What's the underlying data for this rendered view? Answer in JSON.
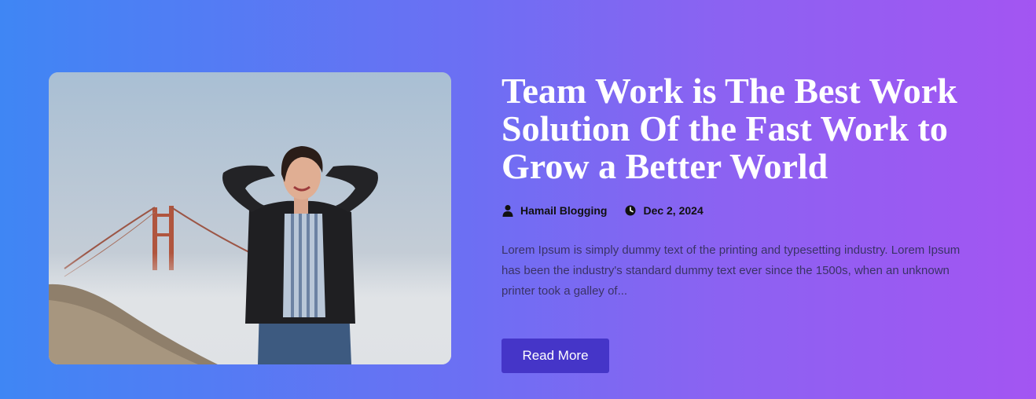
{
  "post": {
    "image_alt": "Woman in leather jacket smiling with eyes closed in front of fog-covered bridge",
    "title": "Team Work is The Best Work Solution Of the Fast Work to Grow a Better World",
    "author": "Hamail Blogging",
    "author_icon": "user-icon",
    "date": "Dec 2, 2024",
    "date_icon": "clock-icon",
    "excerpt": "Lorem Ipsum is simply dummy text of the printing and typesetting industry. Lorem Ipsum has been the industry's standard dummy text ever since the 1500s, when an unknown printer took a galley of...",
    "read_more_label": "Read More"
  },
  "colors": {
    "gradient_start": "#3f86f4",
    "gradient_end": "#a355f2",
    "button": "#4535c8",
    "title": "#ffffff",
    "meta_text": "#111111",
    "excerpt_text": "#3a3366"
  }
}
